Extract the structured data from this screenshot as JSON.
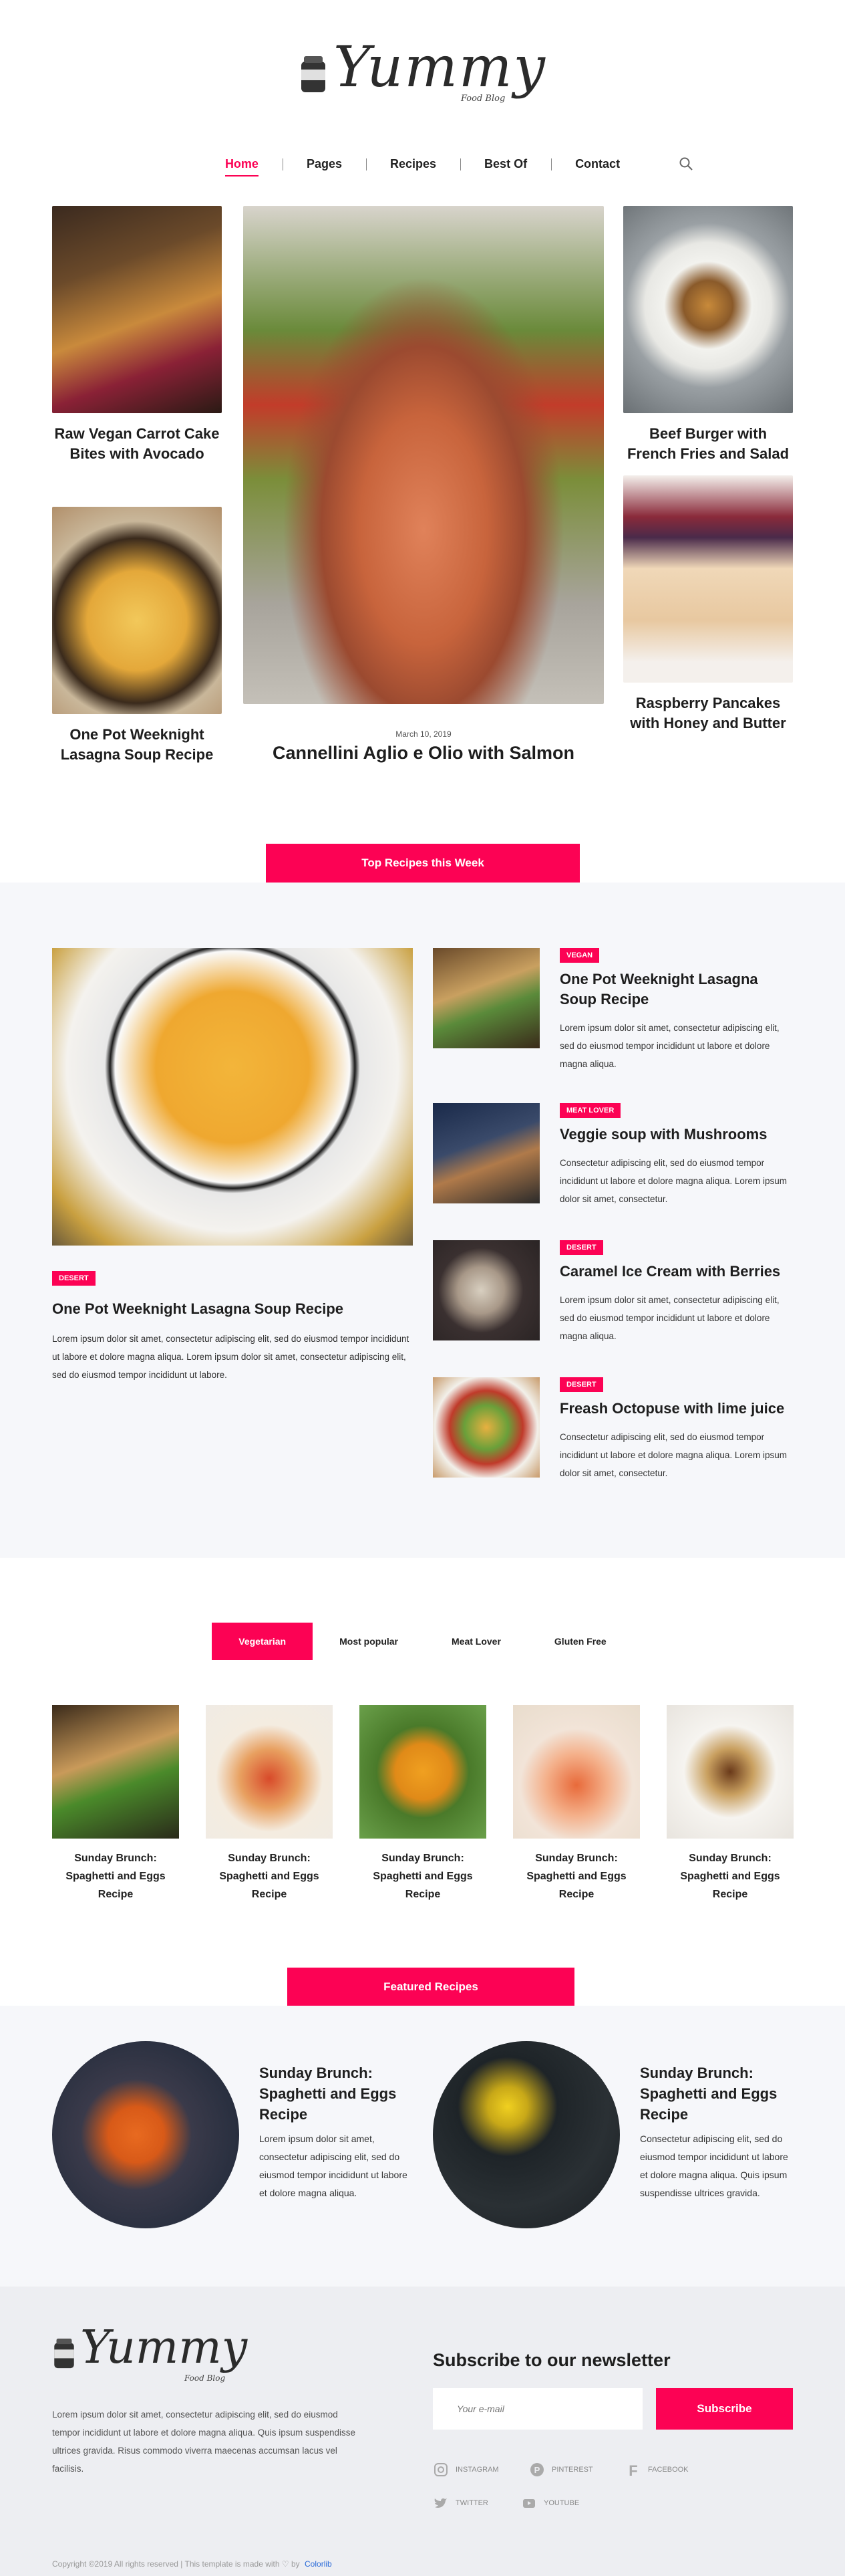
{
  "brand": {
    "name": "Yummy",
    "tagline": "Food Blog"
  },
  "nav": {
    "items": [
      "Home",
      "Pages",
      "Recipes",
      "Best Of",
      "Contact"
    ],
    "active": "Home"
  },
  "hero": {
    "left_top": "Raw Vegan Carrot Cake Bites with Avocado",
    "left_bottom": "One Pot Weeknight Lasagna Soup Recipe",
    "center_date": "March 10, 2019",
    "center_title": "Cannellini Aglio e Olio with Salmon",
    "right_top": "Beef Burger with French Fries and Salad",
    "right_bottom": "Raspberry Pancakes with Honey and Butter"
  },
  "top_week": {
    "button": "Top Recipes this Week",
    "main": {
      "tag": "DESERT",
      "title": "One Pot Weeknight Lasagna Soup Recipe",
      "text": "Lorem ipsum dolor sit amet, consectetur adipiscing elit, sed do eiusmod tempor incididunt ut labore et dolore magna aliqua. Lorem ipsum dolor sit amet, consectetur adipiscing elit, sed do eiusmod tempor incididunt ut labore."
    },
    "items": [
      {
        "tag": "VEGAN",
        "title": "One Pot Weeknight Lasagna Soup Recipe",
        "text": "Lorem ipsum dolor sit amet, consectetur adipiscing elit, sed do eiusmod tempor incididunt ut labore et dolore magna aliqua."
      },
      {
        "tag": "MEAT LOVER",
        "title": "Veggie soup with Mushrooms",
        "text": "Consectetur adipiscing elit, sed do eiusmod tempor incididunt ut labore et dolore magna aliqua. Lorem ipsum dolor sit amet, consectetur."
      },
      {
        "tag": "DESERT",
        "title": "Caramel Ice Cream with Berries",
        "text": "Lorem ipsum dolor sit amet, consectetur adipiscing elit, sed do eiusmod tempor incididunt ut labore et dolore magna aliqua."
      },
      {
        "tag": "DESERT",
        "title": "Freash Octopuse with lime juice",
        "text": "Consectetur adipiscing elit, sed do eiusmod tempor incididunt ut labore et dolore magna aliqua. Lorem ipsum dolor sit amet, consectetur."
      }
    ]
  },
  "tabs": {
    "items": [
      "Vegetarian",
      "Most popular",
      "Meat Lover",
      "Gluten Free"
    ],
    "active": "Vegetarian"
  },
  "grid": [
    "Sunday Brunch: Spaghetti and Eggs Recipe",
    "Sunday Brunch: Spaghetti and Eggs Recipe",
    "Sunday Brunch: Spaghetti and Eggs Recipe",
    "Sunday Brunch: Spaghetti and Eggs Recipe",
    "Sunday Brunch: Spaghetti and Eggs Recipe"
  ],
  "featured": {
    "button": "Featured Recipes",
    "items": [
      {
        "title": "Sunday Brunch: Spaghetti and Eggs Recipe",
        "text": "Lorem ipsum dolor sit amet, consectetur adipiscing elit, sed do eiusmod tempor incididunt ut labore et dolore magna aliqua."
      },
      {
        "title": "Sunday Brunch: Spaghetti and Eggs Recipe",
        "text": "Consectetur adipiscing elit, sed do eiusmod tempor incididunt ut labore et dolore magna aliqua. Quis ipsum suspendisse ultrices gravida."
      }
    ]
  },
  "footer": {
    "about": "Lorem ipsum dolor sit amet, consectetur adipiscing elit, sed do eiusmod tempor incididunt ut labore et dolore magna aliqua. Quis ipsum suspendisse ultrices gravida. Risus commodo viverra maecenas accumsan lacus vel facilisis.",
    "newsletter_title": "Subscribe to our newsletter",
    "email_placeholder": "Your e-mail",
    "subscribe": "Subscribe",
    "social": [
      "INSTAGRAM",
      "PINTEREST",
      "FACEBOOK",
      "TWITTER",
      "YOUTUBE"
    ],
    "copyright": "Copyright ©2019 All rights reserved | This template is made with ♡ by",
    "credit": "Colorlib"
  },
  "colors": {
    "accent": "#fc0254",
    "section_gray": "#f6f7fa",
    "footer_bg": "#edeef2"
  }
}
